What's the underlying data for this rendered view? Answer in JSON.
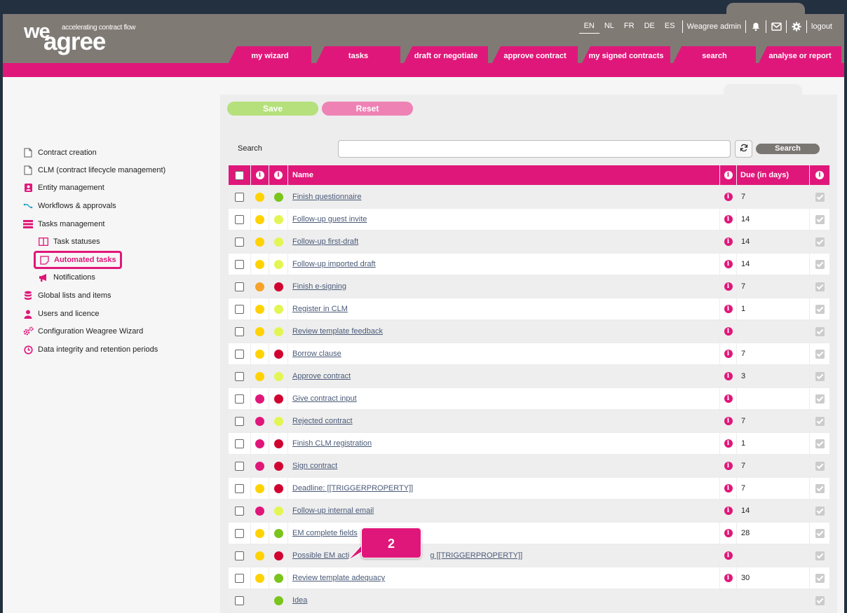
{
  "header": {
    "logo_we": "we",
    "logo_agree": "agree",
    "tagline": "accelerating contract flow",
    "languages": [
      "EN",
      "NL",
      "FR",
      "DE",
      "ES"
    ],
    "active_language": "EN",
    "user_name": "Weagree admin",
    "logout_label": "logout",
    "nav_tabs": [
      "my wizard",
      "tasks",
      "draft or negotiate",
      "approve contract",
      "my signed contracts",
      "search",
      "analyse or report"
    ]
  },
  "sidebar": {
    "items": [
      {
        "label": "Contract creation",
        "icon": "document-icon"
      },
      {
        "label": "CLM (contract lifecycle management)",
        "icon": "document-icon"
      },
      {
        "label": "Entity management",
        "icon": "contact-card-icon"
      },
      {
        "label": "Workflows & approvals",
        "icon": "workflow-icon"
      },
      {
        "label": "Tasks management",
        "icon": "tasks-icon"
      },
      {
        "label": "Task statuses",
        "icon": "columns-icon"
      },
      {
        "label": "Automated tasks",
        "icon": "note-icon"
      },
      {
        "label": "Notifications",
        "icon": "megaphone-icon"
      },
      {
        "label": "Global lists and items",
        "icon": "database-icon"
      },
      {
        "label": "Users and licence",
        "icon": "user-icon"
      },
      {
        "label": "Configuration Weagree Wizard",
        "icon": "gears-icon"
      },
      {
        "label": "Data integrity and retention periods",
        "icon": "clock-icon"
      }
    ]
  },
  "actions": {
    "save_label": "Save",
    "reset_label": "Reset",
    "search_label": "Search",
    "search_value": "",
    "search_button": "Search"
  },
  "table": {
    "headers": {
      "name": "Name",
      "due": "Due (in days)",
      "info_glyph": "i"
    },
    "rows": [
      {
        "name": "Finish questionnaire",
        "c1": "#ffd200",
        "c2": "#7ac41c",
        "due": "7"
      },
      {
        "name": "Follow-up guest invite",
        "c1": "#ffd200",
        "c2": "#e3f553",
        "due": "14"
      },
      {
        "name": "Follow-up first-draft",
        "c1": "#ffd200",
        "c2": "#e3f553",
        "due": "14"
      },
      {
        "name": "Follow-up imported draft",
        "c1": "#ffd200",
        "c2": "#e3f553",
        "due": "14"
      },
      {
        "name": "Finish e-signing",
        "c1": "#f7a229",
        "c2": "#d1022f",
        "due": "7"
      },
      {
        "name": "Register in CLM",
        "c1": "#ffd200",
        "c2": "#e3f553",
        "due": "1"
      },
      {
        "name": "Review template feedback",
        "c1": "#ffd200",
        "c2": "#e3f553",
        "due": ""
      },
      {
        "name": "Borrow clause",
        "c1": "#ffd200",
        "c2": "#d1022f",
        "due": "7"
      },
      {
        "name": "Approve contract",
        "c1": "#ffd200",
        "c2": "#e3f553",
        "due": "3"
      },
      {
        "name": "Give contract input",
        "c1": "#e0177a",
        "c2": "#d1022f",
        "due": ""
      },
      {
        "name": "Rejected contract",
        "c1": "#e0177a",
        "c2": "#e3f553",
        "due": "7"
      },
      {
        "name": "Finish CLM registration",
        "c1": "#e0177a",
        "c2": "#d1022f",
        "due": "1"
      },
      {
        "name": "Sign contract",
        "c1": "#e0177a",
        "c2": "#d1022f",
        "due": "7"
      },
      {
        "name": "Deadline: [[TRIGGERPROPERTY]]",
        "c1": "#ffd200",
        "c2": "#d1022f",
        "due": "7"
      },
      {
        "name": "Follow-up internal email",
        "c1": "#e0177a",
        "c2": "#e3f553",
        "due": "14"
      },
      {
        "name": "EM complete fields",
        "c1": "#ffd200",
        "c2": "#7ac41c",
        "due": "28"
      },
      {
        "name": "Possible EM acti",
        "name_tail": "g [[TRIGGERPROPERTY]]",
        "c1": "#ffd200",
        "c2": "#d1022f",
        "due": ""
      },
      {
        "name": "Review template adequacy",
        "c1": "#ffd200",
        "c2": "#7ac41c",
        "due": "30"
      },
      {
        "name": "Idea",
        "c1": "#eeeeee",
        "c2": "#7ac41c",
        "due": "",
        "no_info": true
      }
    ]
  },
  "callout": {
    "label": "2"
  },
  "colors": {
    "accent": "#e0177a",
    "header_gray": "#807a75",
    "save_green": "#b5e07b",
    "reset_pink": "#ee82b5"
  }
}
